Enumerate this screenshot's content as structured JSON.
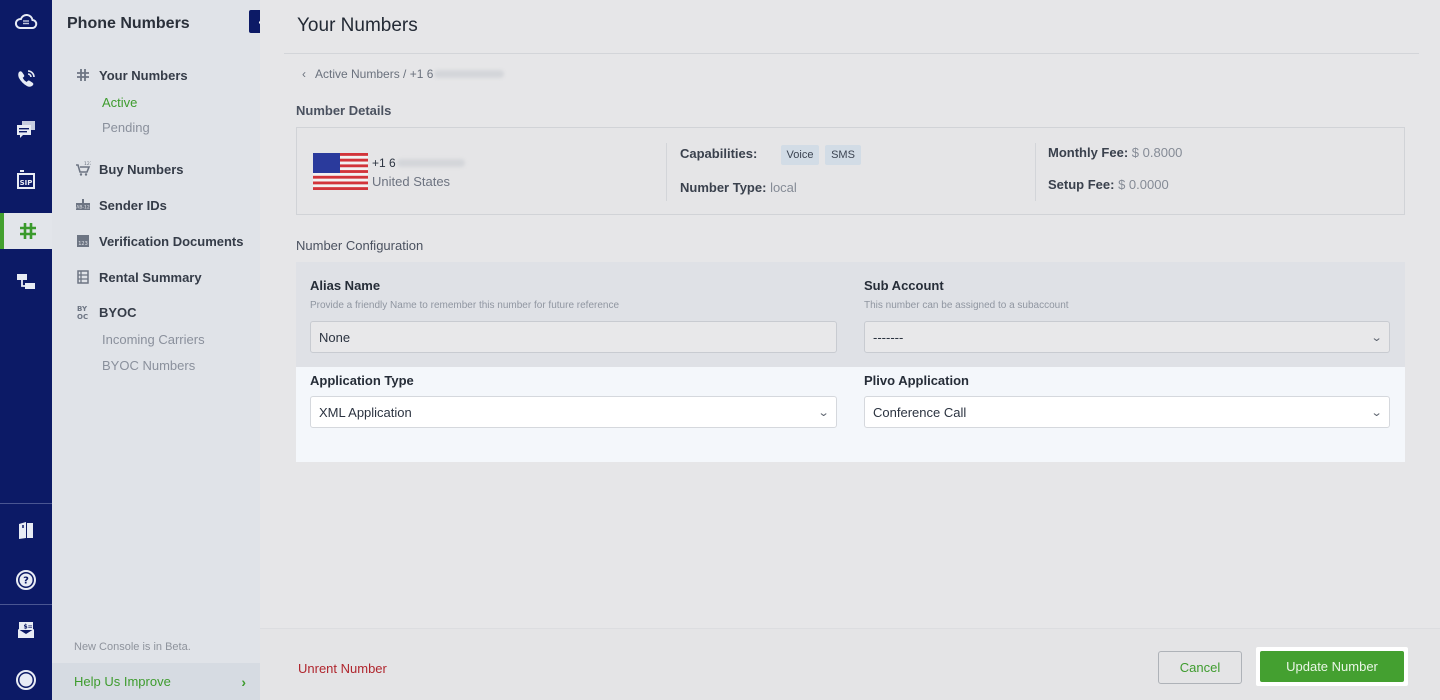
{
  "rail": {
    "items": [
      {
        "icon": "cloud-dialpad-icon"
      },
      {
        "icon": "voice-call-icon"
      },
      {
        "icon": "messaging-icon"
      },
      {
        "icon": "sip-trunking-icon"
      },
      {
        "icon": "phone-numbers-hash-icon",
        "active": true
      },
      {
        "icon": "flow-builder-icon"
      }
    ],
    "bottom_items": [
      {
        "icon": "docs-book-icon"
      },
      {
        "icon": "help-question-icon"
      },
      {
        "icon": "billing-envelope-icon"
      },
      {
        "icon": "account-circle-icon"
      }
    ]
  },
  "subnav": {
    "title": "Phone Numbers",
    "collapse_glyph": "‹",
    "groups": [
      {
        "label": "Your Numbers",
        "icon": "hash-icon",
        "children": [
          {
            "label": "Active",
            "active": true
          },
          {
            "label": "Pending"
          }
        ]
      },
      {
        "label": "Buy Numbers",
        "icon": "cart-icon"
      },
      {
        "label": "Sender IDs",
        "icon": "sender-id-icon"
      },
      {
        "label": "Verification Documents",
        "icon": "document-icon"
      },
      {
        "label": "Rental Summary",
        "icon": "table-icon"
      },
      {
        "label": "BYOC",
        "icon": "byoc-icon",
        "children": [
          {
            "label": "Incoming Carriers"
          },
          {
            "label": "BYOC Numbers"
          }
        ]
      }
    ],
    "beta_note": "New Console is in Beta.",
    "help_label": "Help Us Improve",
    "help_chevron": "›"
  },
  "main": {
    "title": "Your Numbers",
    "breadcrumb": {
      "chevron": "‹",
      "parent": "Active Numbers",
      "separator": " / ",
      "current_prefix": "+1 6"
    },
    "details_label": "Number Details",
    "details": {
      "number_prefix": "+1 6",
      "country": "United States",
      "capabilities_label": "Capabilities:",
      "capabilities": [
        "Voice",
        "SMS"
      ],
      "number_type_label": "Number Type:",
      "number_type": "local",
      "monthly_fee_label": "Monthly Fee:",
      "monthly_fee": "$ 0.8000",
      "setup_fee_label": "Setup Fee:",
      "setup_fee": "$ 0.0000"
    },
    "config_label": "Number Configuration",
    "config": {
      "alias": {
        "label": "Alias Name",
        "help": "Provide a friendly Name to remember this number for future reference",
        "value": "None"
      },
      "sub_account": {
        "label": "Sub Account",
        "help": "This number can be assigned to a subaccount",
        "value": "-------"
      },
      "app_type": {
        "label": "Application Type",
        "value": "XML Application"
      },
      "plivo_app": {
        "label": "Plivo Application",
        "value": "Conference Call"
      }
    }
  },
  "footer": {
    "unrent_label": "Unrent Number",
    "cancel_label": "Cancel",
    "update_label": "Update Number"
  },
  "colors": {
    "rail": "#0c1a66",
    "accent_green": "#44a030",
    "danger": "#b0262e"
  }
}
